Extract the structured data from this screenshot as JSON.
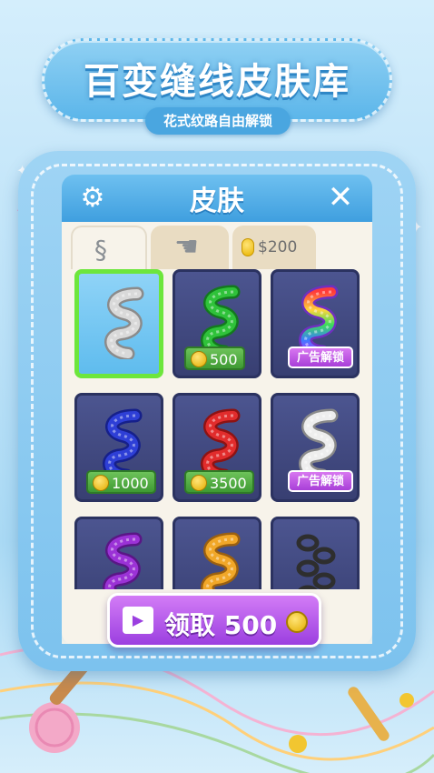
{
  "banner": {
    "title": "百变缝线皮肤库",
    "subtitle": "花式纹路自由解锁"
  },
  "dialog": {
    "title": "皮肤"
  },
  "tabs": [
    {
      "name": "rope-tab",
      "icon": "rope-icon"
    },
    {
      "name": "hand-tab",
      "icon": "hand-icon"
    },
    {
      "name": "price-tab",
      "icon": "coin-icon",
      "label": "$200"
    }
  ],
  "skins": [
    {
      "color": "#d9d9d9",
      "dark": "#8b8b8b",
      "selected": true
    },
    {
      "color": "#2fc23a",
      "dark": "#137a1e",
      "price": "500"
    },
    {
      "color": "rainbow",
      "dark": "#7030c0",
      "ad": "广告解锁"
    },
    {
      "color": "#2e3fd6",
      "dark": "#16208a",
      "price": "1000"
    },
    {
      "color": "#e12c2c",
      "dark": "#8d1313",
      "price": "3500"
    },
    {
      "color": "#eeeeee",
      "dark": "#8a8a8a",
      "ad": "广告解锁"
    },
    {
      "color": "#9b32d6",
      "dark": "#5a1686"
    },
    {
      "color": "#f1a728",
      "dark": "#9b6010"
    },
    {
      "color": "chain",
      "dark": "#333333"
    }
  ],
  "claim": {
    "label": "领取 500",
    "icon_text": "广告"
  },
  "colors": {
    "accent": "#3f9fdf",
    "selected_border": "#6de63c",
    "ad_purple": "#a83fd8"
  }
}
